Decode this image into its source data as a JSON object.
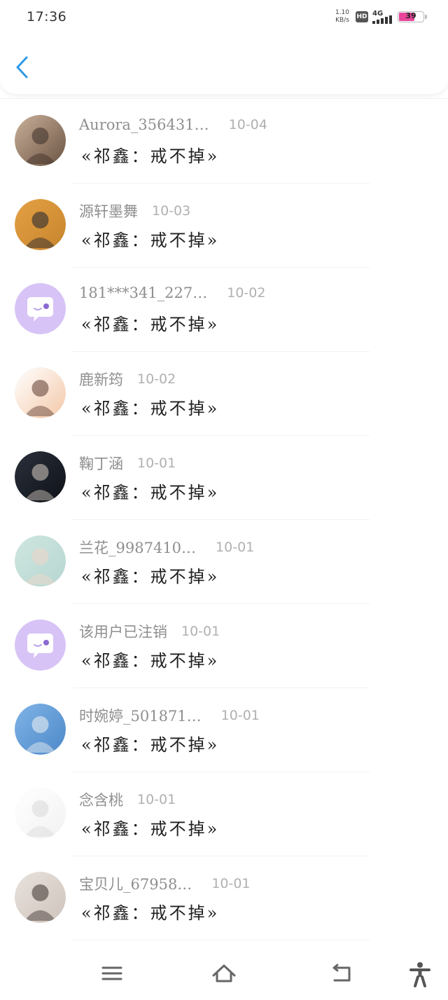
{
  "status": {
    "time": "17:36",
    "net_speed_top": "1.10",
    "net_speed_bottom": "KB/s",
    "hd": "HD",
    "network": "4G",
    "battery": "39",
    "battery_color": "#e8459a"
  },
  "header": {
    "back_icon": "chevron-left-icon",
    "accent": "#2d9ae8"
  },
  "items": [
    {
      "user": "Aurora_356431…",
      "date": "10-04",
      "text": "«祁鑫：戒不掉»",
      "avatar": "photo-avatar-brown"
    },
    {
      "user": "源轩墨舞",
      "date": "10-03",
      "text": "«祁鑫：戒不掉»",
      "avatar": "photo-avatar-orange"
    },
    {
      "user": "181***341_227…",
      "date": "10-02",
      "text": "«祁鑫：戒不掉»",
      "avatar": "default-chat-avatar"
    },
    {
      "user": "鹿新筠",
      "date": "10-02",
      "text": "«祁鑫：戒不掉»",
      "avatar": "cartoon-girl-avatar"
    },
    {
      "user": "鞠丁涵",
      "date": "10-01",
      "text": "«祁鑫：戒不掉»",
      "avatar": "photo-avatar-dark"
    },
    {
      "user": "兰花_9987410…",
      "date": "10-01",
      "text": "«祁鑫：戒不掉»",
      "avatar": "photo-avatar-pastel"
    },
    {
      "user": "该用户已注销",
      "date": "10-01",
      "text": "«祁鑫：戒不掉»",
      "avatar": "default-chat-avatar"
    },
    {
      "user": "时婉婷_501871…",
      "date": "10-01",
      "text": "«祁鑫：戒不掉»",
      "avatar": "photo-avatar-blue"
    },
    {
      "user": "念含桃",
      "date": "10-01",
      "text": "«祁鑫：戒不掉»",
      "avatar": "photo-avatar-faded"
    },
    {
      "user": "宝贝儿_67958…",
      "date": "10-01",
      "text": "«祁鑫：戒不掉»",
      "avatar": "photo-avatar-girl"
    }
  ],
  "nav": {
    "menu_icon": "menu-icon",
    "home_icon": "home-icon",
    "back_icon": "back-icon",
    "accessibility_icon": "accessibility-icon"
  }
}
